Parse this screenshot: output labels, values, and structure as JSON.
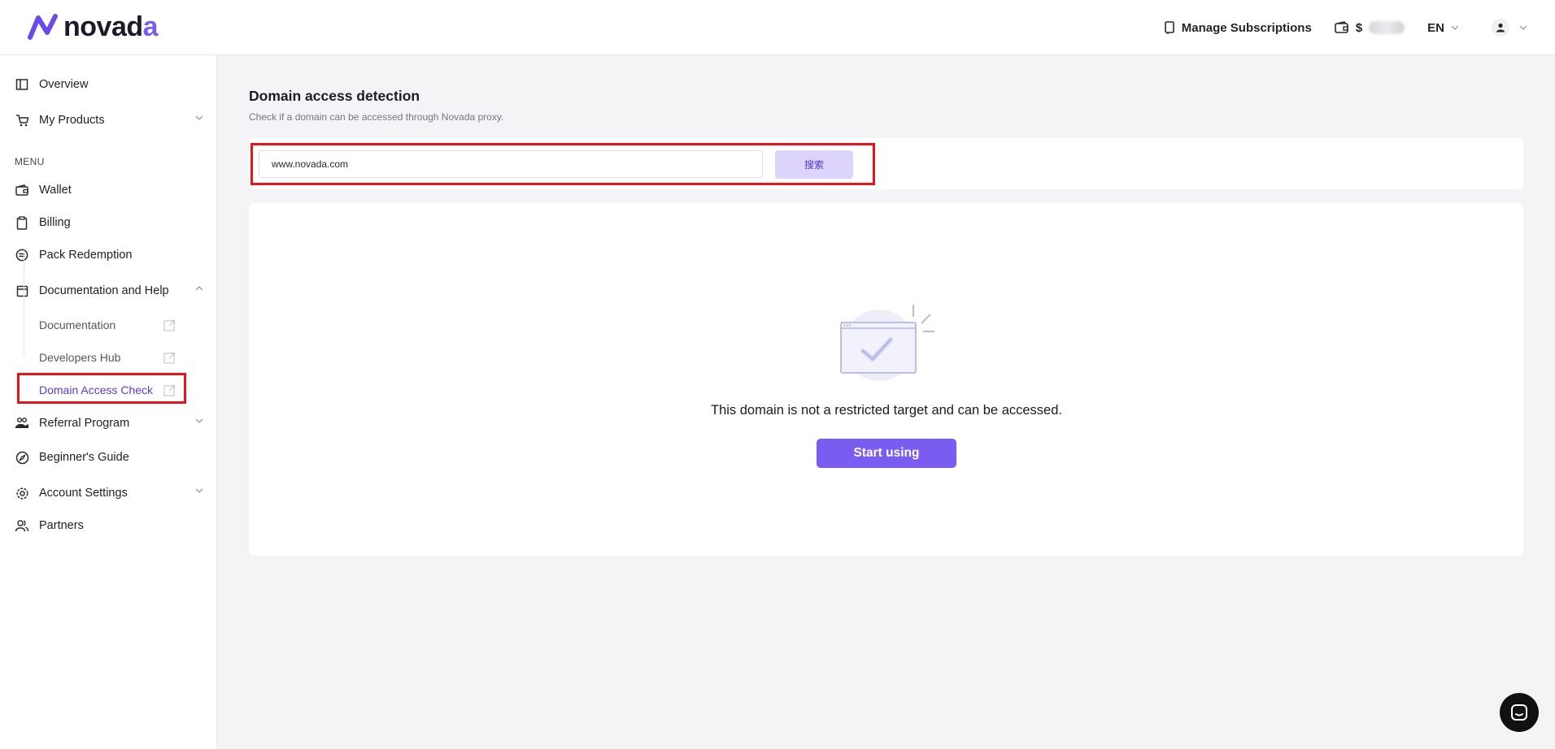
{
  "header": {
    "logo_prefix": "novad",
    "logo_accent": "a",
    "manage_subscriptions": "Manage Subscriptions",
    "wallet_currency": "$",
    "language": "EN"
  },
  "sidebar": {
    "overview": "Overview",
    "my_products": "My Products",
    "menu_label": "MENU",
    "wallet": "Wallet",
    "billing": "Billing",
    "pack_redemption": "Pack Redemption",
    "documentation_and_help": "Documentation and Help",
    "documentation": "Documentation",
    "developers_hub": "Developers Hub",
    "domain_access_check": "Domain Access Check",
    "referral_program": "Referral Program",
    "beginners_guide": "Beginner's Guide",
    "account_settings": "Account Settings",
    "partners": "Partners"
  },
  "main": {
    "title": "Domain access detection",
    "subtitle": "Check if a domain can be accessed through Novada proxy.",
    "search_value": "www.novada.com",
    "search_button": "搜索",
    "result_message": "This domain is not a restricted target and can be accessed.",
    "start_button": "Start using"
  },
  "colors": {
    "accent": "#7a5cf1",
    "highlight": "#e8141c",
    "active_link": "#5b39d8"
  }
}
